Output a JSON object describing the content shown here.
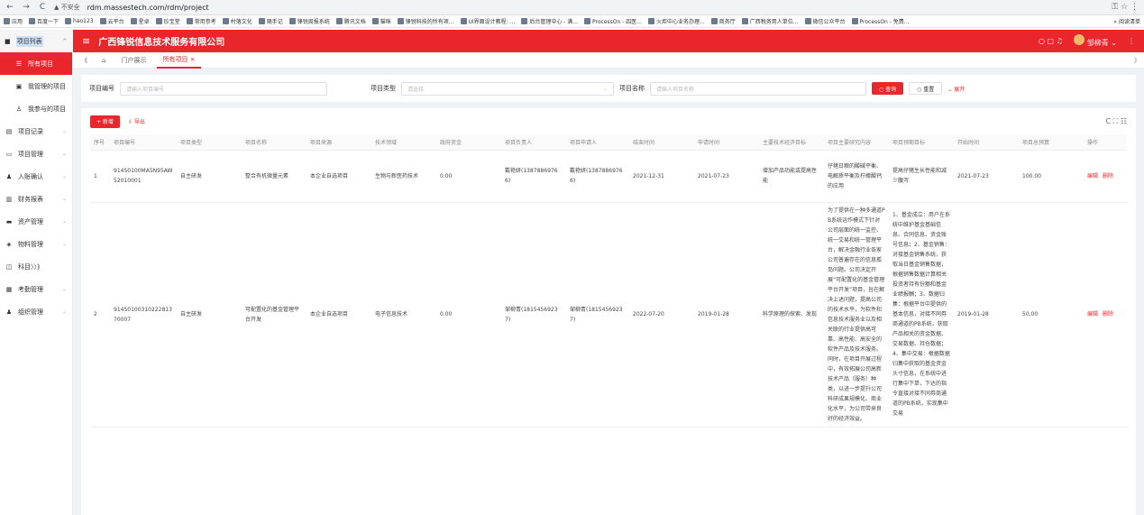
{
  "browser": {
    "back": "←",
    "forward": "→",
    "reload": "C",
    "insecure": "▲ 不安全",
    "url": "rdm.massestech.com/rdm/project",
    "right_icons": "⚿ ☆ ⋮"
  },
  "bookmarks": [
    "应用",
    "百度一下",
    "hao123",
    "云平台",
    "星卓",
    "珍宝堂",
    "常用参考",
    "村落文化",
    "随手记",
    "锋锐周报系统",
    "腾讯文档",
    "猫咪",
    "锋锐科技的所有项...",
    "UI界面设计教程: ...",
    "后台管理中心 - 满...",
    "ProcessOn - 四医...",
    "火炬中心业务办理...",
    "商务厅",
    "广西税务用人单位...",
    "微信公众平台",
    "ProcessOn - 免费..."
  ],
  "bookmarks_right": "» 阅读清单",
  "sidebar": {
    "header": "项目列表",
    "items": [
      {
        "label": "所有项目",
        "icon": "☰",
        "sub": true,
        "active": true
      },
      {
        "label": "我管理的项目",
        "icon": "▣",
        "sub": true
      },
      {
        "label": "我参与的项目",
        "icon": "♙",
        "sub": true
      },
      {
        "label": "项目记录",
        "icon": "▤",
        "chev": "⌄"
      },
      {
        "label": "项目管理",
        "icon": "▭",
        "chev": "⌄"
      },
      {
        "label": "入账确认",
        "icon": "♟",
        "chev": "⌄"
      },
      {
        "label": "财务报表",
        "icon": "▥",
        "chev": "⌄"
      },
      {
        "label": "资产管理",
        "icon": "▬",
        "chev": "⌄"
      },
      {
        "label": "物料管理",
        "icon": "◈",
        "chev": "⌄"
      },
      {
        "label": "科目〉〉》",
        "icon": "◫"
      },
      {
        "label": "考勤管理",
        "icon": "▦",
        "chev": "⌄"
      },
      {
        "label": "组织管理",
        "icon": "♟",
        "chev": "⌄"
      }
    ]
  },
  "topbar": {
    "menu": "≡",
    "company": "广西锋锐信息技术服务有限公司",
    "tool_icons": "○ ▢ ♫",
    "user": "邹柳青 ⌄",
    "more": "⋮"
  },
  "tabs": {
    "collapse": "《",
    "home": "⌂",
    "items": [
      "门户展示",
      "所有项目 ×"
    ],
    "right": "》"
  },
  "filter": {
    "code_label": "项目编号",
    "code_placeholder": "请输入项目编号",
    "type_label": "项目类型",
    "type_placeholder": "请选择",
    "name_label": "项目名称",
    "name_placeholder": "请输入项目名称",
    "search": "○ 查询",
    "reset": "○ 重置",
    "expand": "⌄ 展开"
  },
  "toolbar": {
    "add": "+ 新增",
    "export": "⇩ 导出",
    "right_icons": "C ⛶ ☷"
  },
  "table": {
    "columns": [
      "序号",
      "项目编号",
      "项目类型",
      "项目名称",
      "项目来源",
      "技术领域",
      "政府资金",
      "项目负责人",
      "项目申请人",
      "结束时间",
      "申请时间",
      "主要技术经济目标",
      "项目主要研究内容",
      "项目预期目标",
      "开始时间",
      "项目总预算",
      "操作"
    ],
    "rows": [
      {
        "no": "1",
        "code": "91450100MA5N95AW52010001",
        "type": "自主研发",
        "name": "整合有机微量元素",
        "source": "本企业自选项目",
        "field": "生物与新医药技术",
        "gov_funds": "0.00",
        "leader": "戴艳妍(13878869766)",
        "applicant": "戴艳妍(13878869766)",
        "end": "2021-12-31",
        "apply": "2021-07-23",
        "goal": "增加产品功能或提高性能",
        "content": "仔猪日粮的酸碱平衡、电解质平衡及柠檬酸钙的应用",
        "expected": "提高仔猪生长性能和减少腹泻",
        "start": "2021-07-23",
        "budget": "100.00",
        "op_edit": "编辑",
        "op_delete": "删除"
      },
      {
        "no": "2",
        "code": "91450100310222813 70007",
        "type": "自主研发",
        "name": "可配置化的基金管理平台开发",
        "source": "本企业自选项目",
        "field": "电子信息技术",
        "gov_funds": "0.00",
        "leader": "邹柳青(18154569237)",
        "applicant": "邹柳青(18154569237)",
        "end": "2022-07-20",
        "apply": "2019-01-28",
        "goal": "科学原理的探索、发现",
        "content": "为了提供在一种多通道PB系统运作模式下针对公司层面的统一监控、统一交易和统一管理平台，解决金融行业各家公司普遍存在的信息孤岛问题。公司决定开展“可配置化的基金管理平台开发”项目，旨在解决上述问题，提高公司的技术水平，为软件和信息技术服务业以及相关联的行业提供高可靠、高性能、高安全的软件产品及技术服务。同时，在项目开展过程中，有效拓展公司高新技术产品（服务）种类，以进一步提升公司科研成果规模化、商业化水平，为公司带来良好的经济效益。",
        "expected": "1、基金成立：用户在系统中维护基金基础信息、合同信息、资金账号信息；2、基金销售：对接基金销售系统，获取当日基金销售数据，根据销售数据计算相关投资者持有份额和基金业绩报酬；3、数据归集：根据平台中提供的基本信息，对接不同券商通道的PB系统，获取产品相关的资金数据、交易数据、持仓数据；4、集中交易：根据数据归集中获取的基金资金头寸信息，在系统中进行集中下单，下达的指令直接对接不同券商通道的PB系统，实现集中交易",
        "start": "2019-01-28",
        "budget": "50.00",
        "op_edit": "编辑",
        "op_delete": "删除"
      }
    ]
  }
}
